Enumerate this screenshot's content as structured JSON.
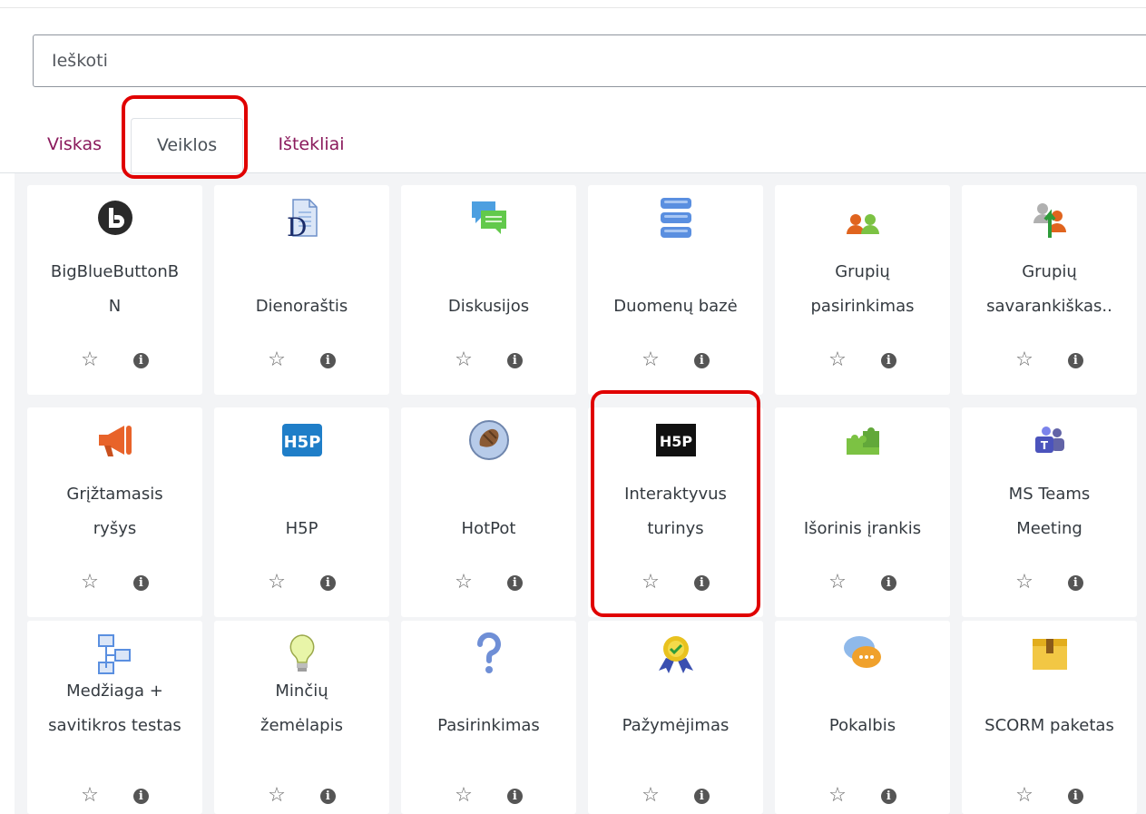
{
  "search": {
    "placeholder": "Ieškoti"
  },
  "tabs": [
    {
      "label": "Viskas",
      "active": false
    },
    {
      "label": "Veiklos",
      "active": true
    },
    {
      "label": "Ištekliai",
      "active": false
    }
  ],
  "activities": [
    {
      "name": "BigBlueButtonB\nN",
      "icon": "bigbluebutton-icon"
    },
    {
      "name": "Dienoraštis",
      "icon": "journal-icon"
    },
    {
      "name": "Diskusijos",
      "icon": "forum-icon"
    },
    {
      "name": "Duomenų bazė",
      "icon": "database-icon"
    },
    {
      "name": "Grupių\npasirinkimas",
      "icon": "group-choice-icon"
    },
    {
      "name": "Grupių\nsavarankiškas..",
      "icon": "group-self-selection-icon"
    },
    {
      "name": "Grįžtamasis\nryšys",
      "icon": "feedback-megaphone-icon"
    },
    {
      "name": "H5P",
      "icon": "h5p-icon"
    },
    {
      "name": "HotPot",
      "icon": "hotpot-icon"
    },
    {
      "name": "Interaktyvus\nturinys",
      "icon": "h5p-black-icon"
    },
    {
      "name": "Išorinis įrankis",
      "icon": "puzzle-icon"
    },
    {
      "name": "MS Teams\nMeeting",
      "icon": "ms-teams-icon"
    },
    {
      "name": "Medžiaga +\nsavitikros testas",
      "icon": "lesson-icon"
    },
    {
      "name": "Minčių\nžemėlapis",
      "icon": "lightbulb-icon"
    },
    {
      "name": "Pasirinkimas",
      "icon": "question-mark-icon"
    },
    {
      "name": "Pažymėjimas",
      "icon": "certificate-icon"
    },
    {
      "name": "Pokalbis",
      "icon": "chat-icon"
    },
    {
      "name": "SCORM paketas",
      "icon": "scorm-package-icon"
    }
  ],
  "colors": {
    "tab_link": "#8a1a5c",
    "highlight": "#e00000",
    "grid_bg": "#f3f4f6"
  }
}
